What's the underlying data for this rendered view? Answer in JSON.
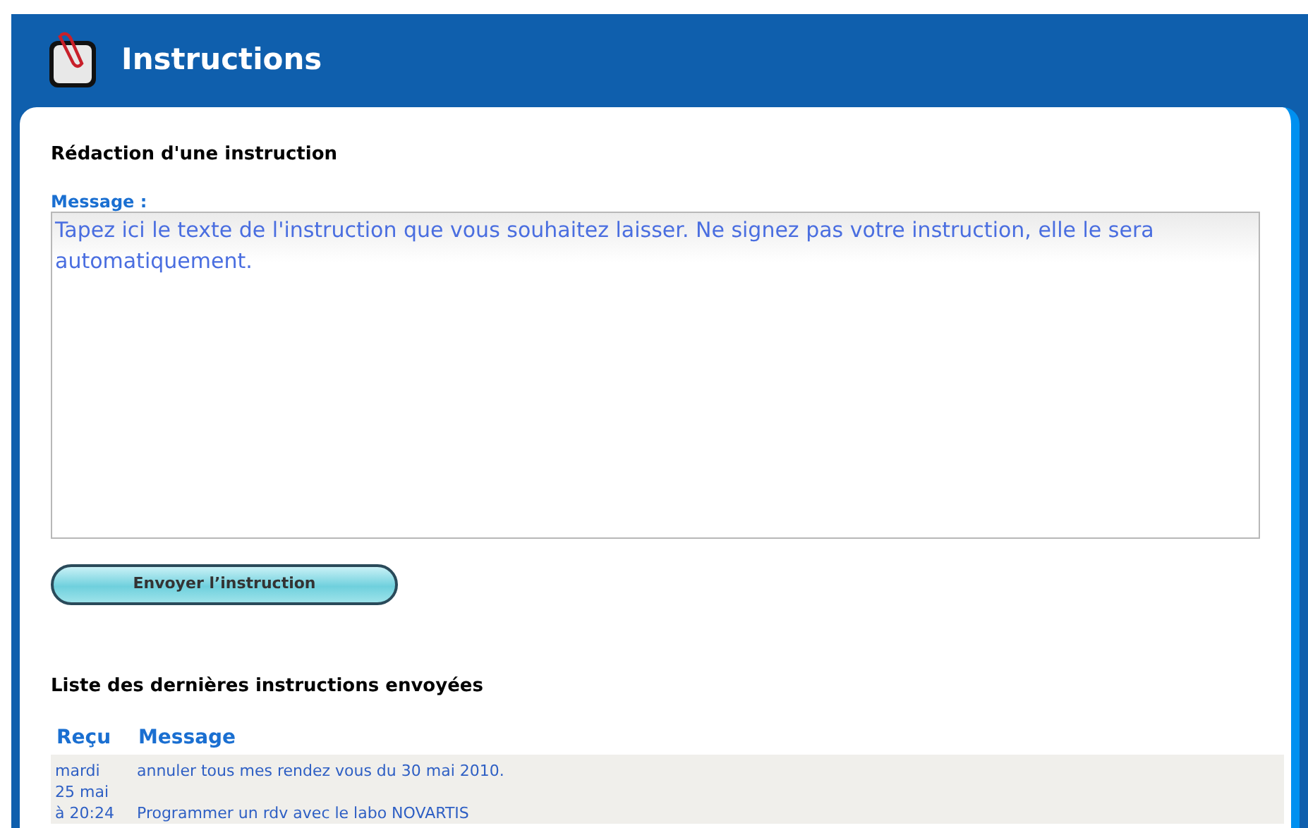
{
  "header": {
    "title": "Instructions"
  },
  "compose": {
    "heading": "Rédaction d'une instruction",
    "label": "Message :",
    "placeholder": "Tapez ici le texte de l'instruction que vous souhaitez laisser. Ne signez pas votre instruction, elle le sera automatiquement.",
    "button": "Envoyer l’instruction"
  },
  "history": {
    "heading": "Liste des dernières instructions envoyées",
    "columns": [
      "Reçu",
      "Message"
    ],
    "rows": [
      {
        "received": [
          "mardi",
          "25 mai",
          "à 20:24"
        ],
        "messages": [
          "annuler tous mes rendez vous du 30 mai 2010.",
          "Programmer un rdv avec le labo NOVARTIS"
        ]
      }
    ]
  }
}
